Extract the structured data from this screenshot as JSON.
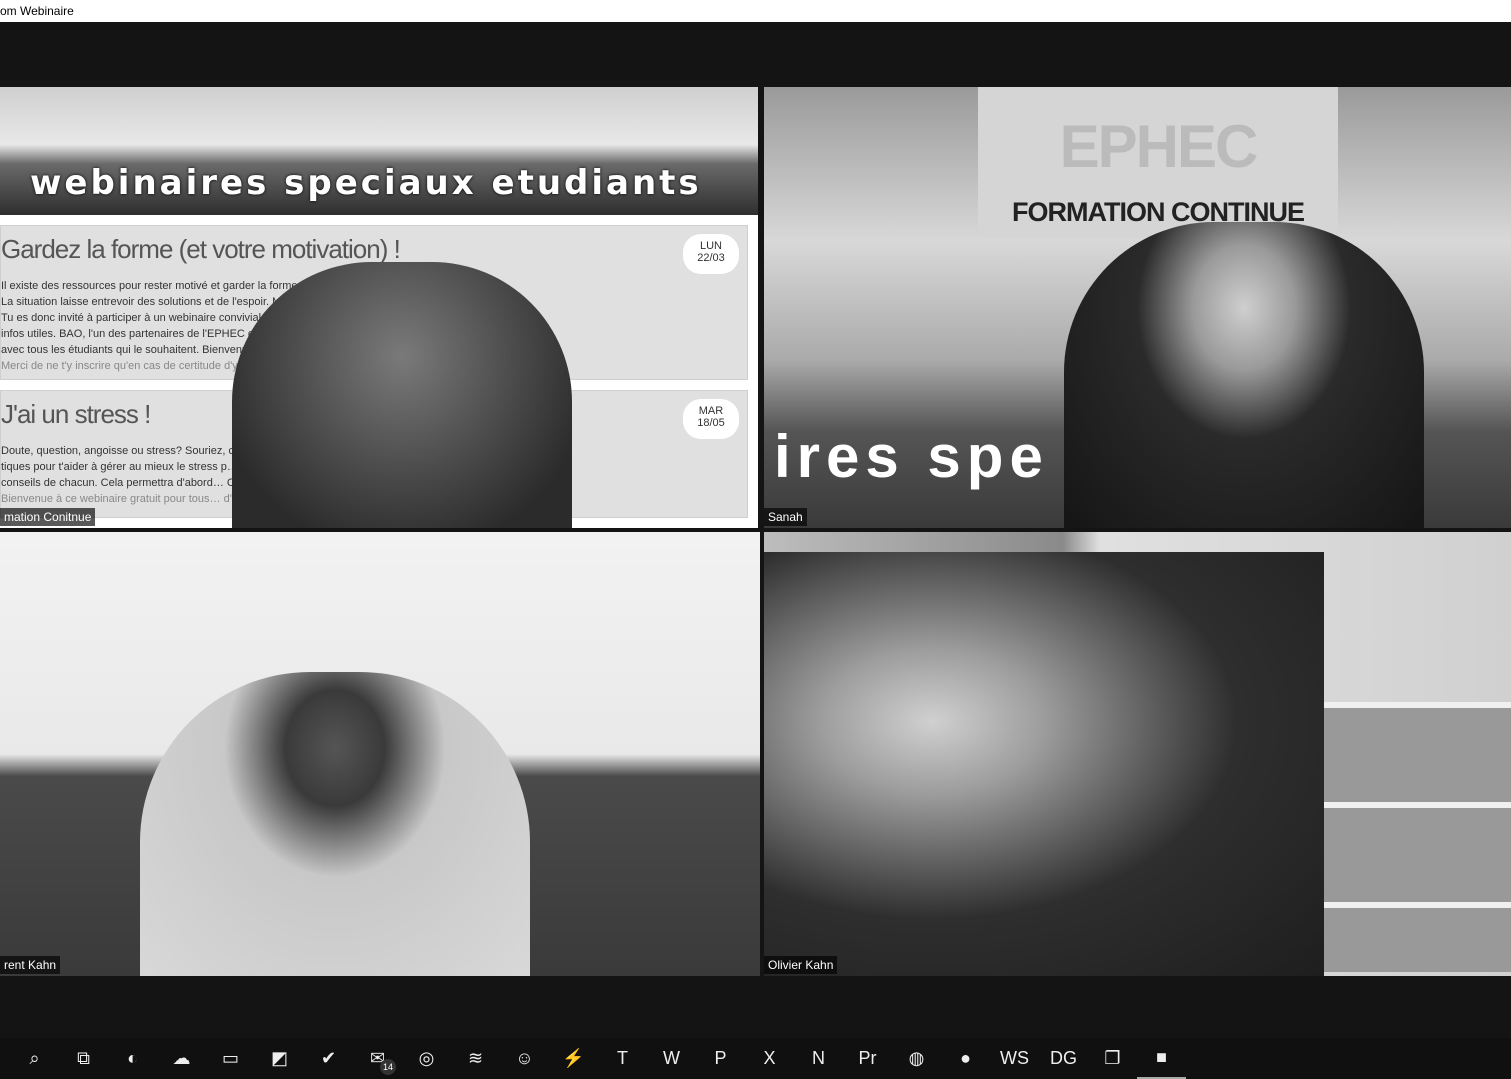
{
  "window": {
    "title": "om Webinaire"
  },
  "tiles": [
    {
      "name": "mation Conitnue",
      "slide": {
        "banner": "webinaires speciaux etudiants",
        "events": [
          {
            "title": "Gardez la forme (et votre motivation) !",
            "badge_day": "LUN",
            "badge_date": "22/03",
            "lines": [
              "Il existe des ressources pour rester motivé et garder la forme sur la … découvrir !",
              "La situation laisse entrevoir des solutions et de l'espoir. Mais, rebo… indispensable.",
              "Tu es donc invité à participer à un webinaire convivial sur le suje… ôt des conseils pratiques et des",
              "infos utiles. BAO, l'un des partenaires de l'EPHEC et très spéci… de partager ses expériences",
              "avec tous les étudiants qui le souhaitent. Bienvenue à ce w… diants !",
              "Merci de ne t'y inscrire qu'en cas de certitude d'y particip…"
            ]
          },
          {
            "title": "J'ai un stress !",
            "badge_day": "MAR",
            "badge_date": "18/05",
            "lines": [
              "Doute, question, angoisse ou stress? Souriez, c'e… ons-réponses pra-",
              "tiques pour t'aider à gérer au mieux le stress p… ment les meilleurs",
              "conseils de chacun. Cela permettra d'abord… Cela te tente ?",
              "Bienvenue à ce webinaire gratuit pour tous… d'y participer."
            ]
          }
        ]
      }
    },
    {
      "name": "Sanah",
      "logo": "EPHEC",
      "logo_sub": "FORMATION CONTINUE",
      "banner": "ires spe        etu"
    },
    {
      "name": "rent Kahn"
    },
    {
      "name": "Olivier Kahn"
    }
  ],
  "taskbar": {
    "items": [
      {
        "icon": "search-icon",
        "glyph": "⌕"
      },
      {
        "icon": "task-view-icon",
        "glyph": "⧉"
      },
      {
        "icon": "app-icon",
        "glyph": "◐"
      },
      {
        "icon": "cloud-icon",
        "glyph": "☁"
      },
      {
        "icon": "folder-icon",
        "glyph": "▭"
      },
      {
        "icon": "sticky-notes-icon",
        "glyph": "◩"
      },
      {
        "icon": "check-icon",
        "glyph": "✔"
      },
      {
        "icon": "mail-icon",
        "glyph": "✉",
        "count": "14"
      },
      {
        "icon": "chrome-icon",
        "glyph": "◎"
      },
      {
        "icon": "spotify-icon",
        "glyph": "≋"
      },
      {
        "icon": "discord-icon",
        "glyph": "☺"
      },
      {
        "icon": "messenger-icon",
        "glyph": "⚡"
      },
      {
        "icon": "teams-icon",
        "glyph": "T"
      },
      {
        "icon": "word-icon",
        "glyph": "W"
      },
      {
        "icon": "powerpoint-icon",
        "glyph": "P"
      },
      {
        "icon": "excel-icon",
        "glyph": "X"
      },
      {
        "icon": "notion-icon",
        "glyph": "N"
      },
      {
        "icon": "premiere-icon",
        "glyph": "Pr"
      },
      {
        "icon": "safari-icon",
        "glyph": "◍"
      },
      {
        "icon": "github-icon",
        "glyph": "●"
      },
      {
        "icon": "webstorm-icon",
        "glyph": "WS"
      },
      {
        "icon": "datagrip-icon",
        "glyph": "DG"
      },
      {
        "icon": "windows-icon",
        "glyph": "❐"
      },
      {
        "icon": "zoom-icon",
        "glyph": "■",
        "active": true
      }
    ]
  }
}
